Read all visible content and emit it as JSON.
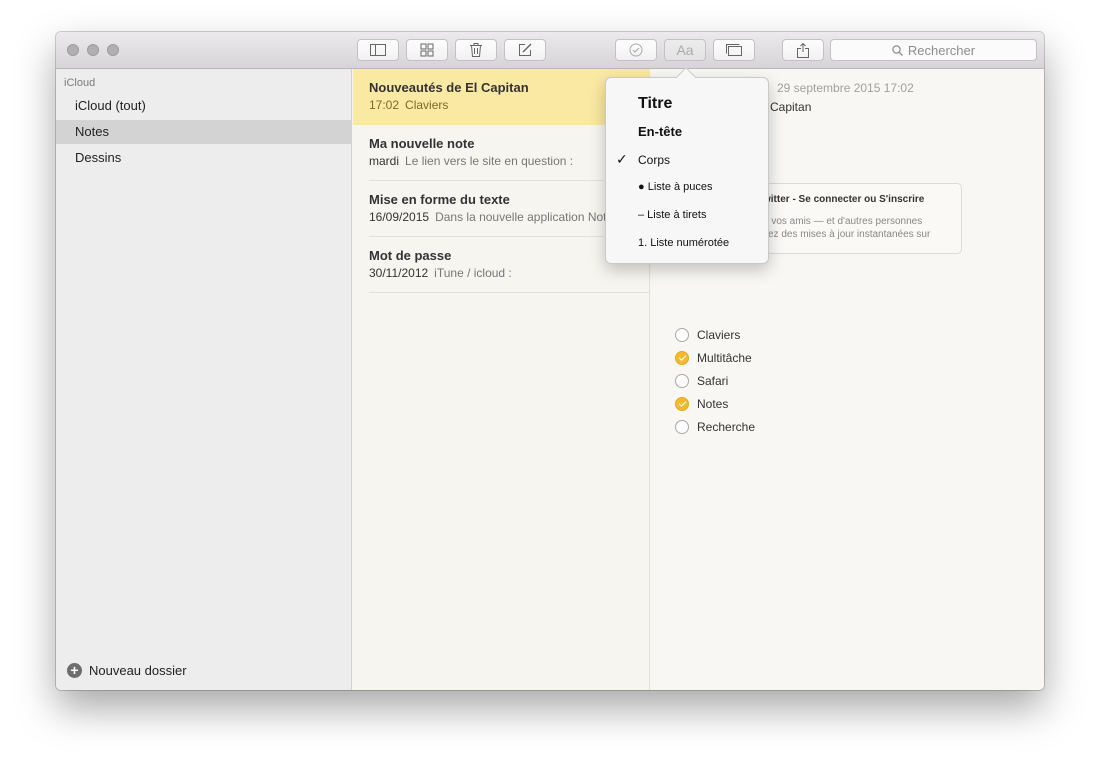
{
  "toolbar": {
    "search_placeholder": "Rechercher",
    "font_button_label": "Aa"
  },
  "sidebar": {
    "account": "iCloud",
    "items": [
      {
        "label": "iCloud (tout)",
        "selected": false
      },
      {
        "label": "Notes",
        "selected": true
      },
      {
        "label": "Dessins",
        "selected": false
      }
    ],
    "new_folder": "Nouveau dossier"
  },
  "notes": [
    {
      "title": "Nouveautés de El Capitan",
      "date": "17:02",
      "preview": "Claviers",
      "selected": true
    },
    {
      "title": "Ma nouvelle note",
      "date": "mardi",
      "preview": "Le lien vers le site en question :",
      "selected": false
    },
    {
      "title": "Mise en forme du texte",
      "date": "16/09/2015",
      "preview": "Dans la nouvelle application Notes",
      "selected": false
    },
    {
      "title": "Mot de passe",
      "date": "30/11/2012",
      "preview": "iTune / icloud :",
      "selected": false
    }
  ],
  "editor": {
    "date": "29 septembre 2015 17:02",
    "title_fragment": "Capitan",
    "link_card": {
      "title": "witter - Se connecter ou S'inscrire",
      "line1": "à vos amis — et d'autres personnes",
      "line2": "vez des mises à jour instantanées sur"
    },
    "checklist": [
      {
        "label": "Claviers",
        "checked": false
      },
      {
        "label": "Multitâche",
        "checked": true
      },
      {
        "label": "Safari",
        "checked": false
      },
      {
        "label": "Notes",
        "checked": true
      },
      {
        "label": "Recherche",
        "checked": false
      }
    ]
  },
  "format_menu": {
    "options": [
      "Titre",
      "En-tête",
      "Corps",
      "● Liste à puces",
      "– Liste à tirets",
      "1. Liste numérotée"
    ],
    "checkmark": "✓",
    "selected": "Corps"
  },
  "colors": {
    "selected_note": "#f9e9a3",
    "check_on": "#f5b82e",
    "sidebar_selected": "#d4d3d4"
  }
}
